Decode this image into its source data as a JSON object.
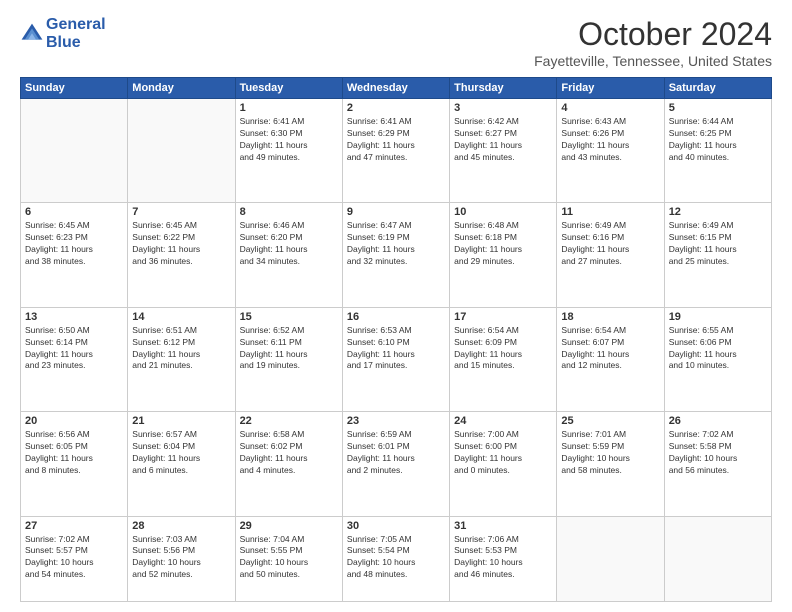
{
  "header": {
    "logo_line1": "General",
    "logo_line2": "Blue",
    "month_title": "October 2024",
    "location": "Fayetteville, Tennessee, United States"
  },
  "weekdays": [
    "Sunday",
    "Monday",
    "Tuesday",
    "Wednesday",
    "Thursday",
    "Friday",
    "Saturday"
  ],
  "weeks": [
    [
      {
        "day": "",
        "detail": ""
      },
      {
        "day": "",
        "detail": ""
      },
      {
        "day": "1",
        "detail": "Sunrise: 6:41 AM\nSunset: 6:30 PM\nDaylight: 11 hours\nand 49 minutes."
      },
      {
        "day": "2",
        "detail": "Sunrise: 6:41 AM\nSunset: 6:29 PM\nDaylight: 11 hours\nand 47 minutes."
      },
      {
        "day": "3",
        "detail": "Sunrise: 6:42 AM\nSunset: 6:27 PM\nDaylight: 11 hours\nand 45 minutes."
      },
      {
        "day": "4",
        "detail": "Sunrise: 6:43 AM\nSunset: 6:26 PM\nDaylight: 11 hours\nand 43 minutes."
      },
      {
        "day": "5",
        "detail": "Sunrise: 6:44 AM\nSunset: 6:25 PM\nDaylight: 11 hours\nand 40 minutes."
      }
    ],
    [
      {
        "day": "6",
        "detail": "Sunrise: 6:45 AM\nSunset: 6:23 PM\nDaylight: 11 hours\nand 38 minutes."
      },
      {
        "day": "7",
        "detail": "Sunrise: 6:45 AM\nSunset: 6:22 PM\nDaylight: 11 hours\nand 36 minutes."
      },
      {
        "day": "8",
        "detail": "Sunrise: 6:46 AM\nSunset: 6:20 PM\nDaylight: 11 hours\nand 34 minutes."
      },
      {
        "day": "9",
        "detail": "Sunrise: 6:47 AM\nSunset: 6:19 PM\nDaylight: 11 hours\nand 32 minutes."
      },
      {
        "day": "10",
        "detail": "Sunrise: 6:48 AM\nSunset: 6:18 PM\nDaylight: 11 hours\nand 29 minutes."
      },
      {
        "day": "11",
        "detail": "Sunrise: 6:49 AM\nSunset: 6:16 PM\nDaylight: 11 hours\nand 27 minutes."
      },
      {
        "day": "12",
        "detail": "Sunrise: 6:49 AM\nSunset: 6:15 PM\nDaylight: 11 hours\nand 25 minutes."
      }
    ],
    [
      {
        "day": "13",
        "detail": "Sunrise: 6:50 AM\nSunset: 6:14 PM\nDaylight: 11 hours\nand 23 minutes."
      },
      {
        "day": "14",
        "detail": "Sunrise: 6:51 AM\nSunset: 6:12 PM\nDaylight: 11 hours\nand 21 minutes."
      },
      {
        "day": "15",
        "detail": "Sunrise: 6:52 AM\nSunset: 6:11 PM\nDaylight: 11 hours\nand 19 minutes."
      },
      {
        "day": "16",
        "detail": "Sunrise: 6:53 AM\nSunset: 6:10 PM\nDaylight: 11 hours\nand 17 minutes."
      },
      {
        "day": "17",
        "detail": "Sunrise: 6:54 AM\nSunset: 6:09 PM\nDaylight: 11 hours\nand 15 minutes."
      },
      {
        "day": "18",
        "detail": "Sunrise: 6:54 AM\nSunset: 6:07 PM\nDaylight: 11 hours\nand 12 minutes."
      },
      {
        "day": "19",
        "detail": "Sunrise: 6:55 AM\nSunset: 6:06 PM\nDaylight: 11 hours\nand 10 minutes."
      }
    ],
    [
      {
        "day": "20",
        "detail": "Sunrise: 6:56 AM\nSunset: 6:05 PM\nDaylight: 11 hours\nand 8 minutes."
      },
      {
        "day": "21",
        "detail": "Sunrise: 6:57 AM\nSunset: 6:04 PM\nDaylight: 11 hours\nand 6 minutes."
      },
      {
        "day": "22",
        "detail": "Sunrise: 6:58 AM\nSunset: 6:02 PM\nDaylight: 11 hours\nand 4 minutes."
      },
      {
        "day": "23",
        "detail": "Sunrise: 6:59 AM\nSunset: 6:01 PM\nDaylight: 11 hours\nand 2 minutes."
      },
      {
        "day": "24",
        "detail": "Sunrise: 7:00 AM\nSunset: 6:00 PM\nDaylight: 11 hours\nand 0 minutes."
      },
      {
        "day": "25",
        "detail": "Sunrise: 7:01 AM\nSunset: 5:59 PM\nDaylight: 10 hours\nand 58 minutes."
      },
      {
        "day": "26",
        "detail": "Sunrise: 7:02 AM\nSunset: 5:58 PM\nDaylight: 10 hours\nand 56 minutes."
      }
    ],
    [
      {
        "day": "27",
        "detail": "Sunrise: 7:02 AM\nSunset: 5:57 PM\nDaylight: 10 hours\nand 54 minutes."
      },
      {
        "day": "28",
        "detail": "Sunrise: 7:03 AM\nSunset: 5:56 PM\nDaylight: 10 hours\nand 52 minutes."
      },
      {
        "day": "29",
        "detail": "Sunrise: 7:04 AM\nSunset: 5:55 PM\nDaylight: 10 hours\nand 50 minutes."
      },
      {
        "day": "30",
        "detail": "Sunrise: 7:05 AM\nSunset: 5:54 PM\nDaylight: 10 hours\nand 48 minutes."
      },
      {
        "day": "31",
        "detail": "Sunrise: 7:06 AM\nSunset: 5:53 PM\nDaylight: 10 hours\nand 46 minutes."
      },
      {
        "day": "",
        "detail": ""
      },
      {
        "day": "",
        "detail": ""
      }
    ]
  ]
}
